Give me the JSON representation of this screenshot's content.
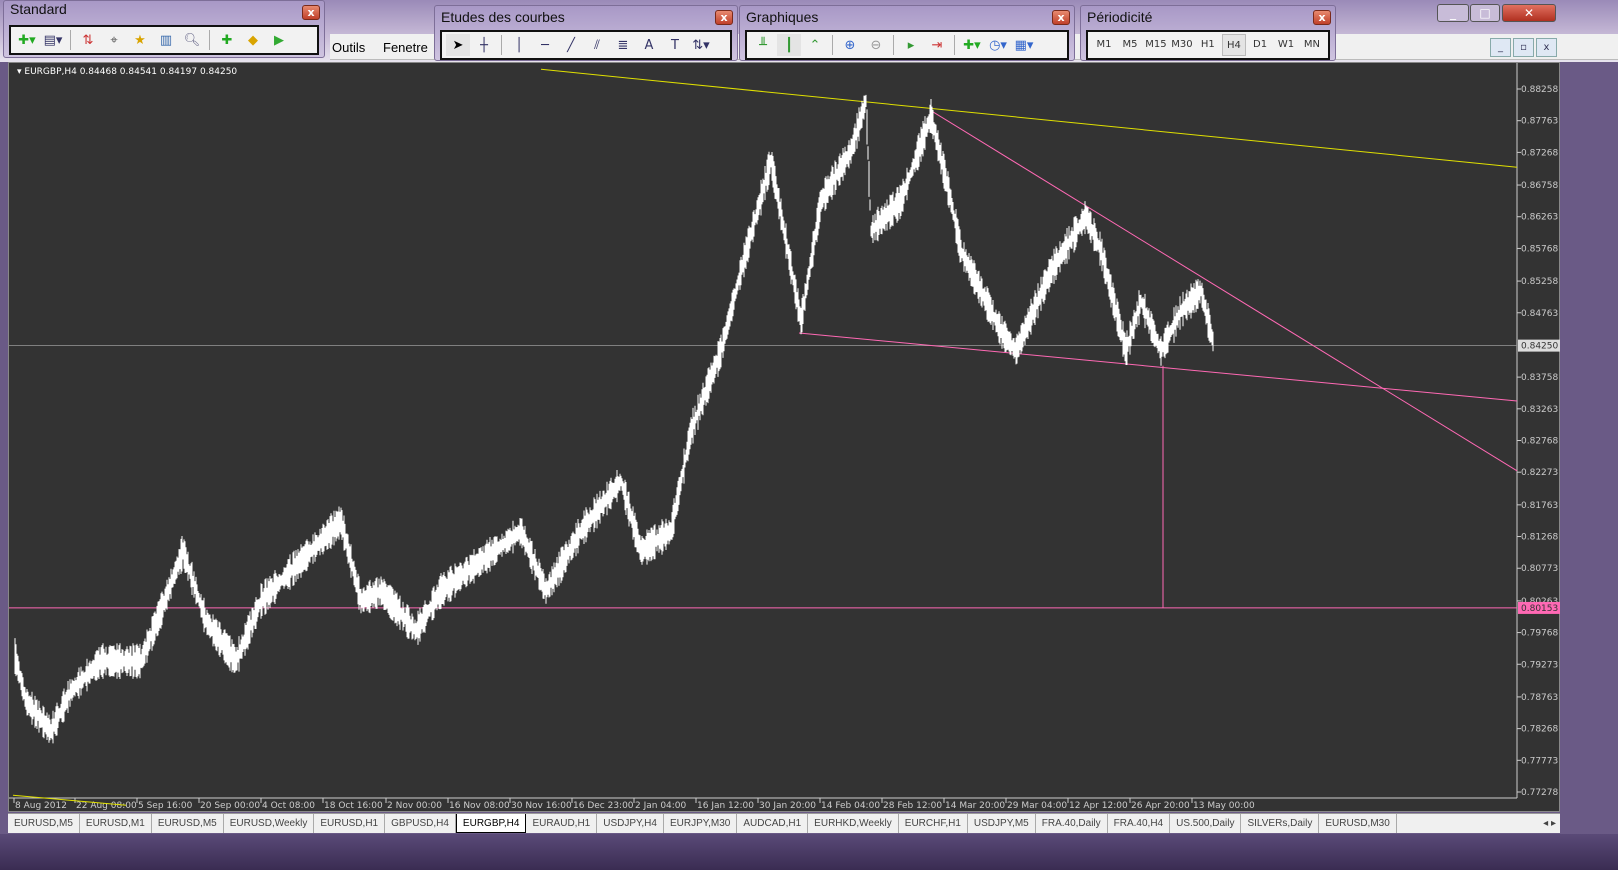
{
  "menu": {
    "tools": "Outils",
    "window": "Fenetre"
  },
  "toolbars": {
    "standard": {
      "title": "Standard",
      "close": "x"
    },
    "studies": {
      "title": "Etudes des courbes",
      "close": "x",
      "text_tool": "A",
      "textlabel_tool": "T"
    },
    "charts": {
      "title": "Graphiques",
      "close": "x"
    },
    "period": {
      "title": "Périodicité",
      "close": "x",
      "items": [
        "M1",
        "M5",
        "M15",
        "M30",
        "H1",
        "H4",
        "D1",
        "W1",
        "MN"
      ],
      "active": "H4"
    }
  },
  "chart": {
    "header": "EURGBP,H4  0.84468 0.84541 0.84197 0.84250"
  },
  "tabs": [
    "EURUSD,M5",
    "EURUSD,M1",
    "EURUSD,M5",
    "EURUSD,Weekly",
    "EURUSD,H1",
    "GBPUSD,H4",
    "EURGBP,H4",
    "EURAUD,H1",
    "USDJPY,H4",
    "EURJPY,M30",
    "AUDCAD,H1",
    "EURHKD,Weekly",
    "EURCHF,H1",
    "USDJPY,M5",
    "FRA.40,Daily",
    "FRA.40,H4",
    "US.500,Daily",
    "SILVERs,Daily",
    "EURUSD,M30"
  ],
  "active_tab": "EURGBP,H4",
  "chart_data": {
    "type": "line",
    "symbol": "EURGBP",
    "timeframe": "H4",
    "ylim": [
      0.77278,
      0.88258
    ],
    "xlim": [
      0,
      1504
    ],
    "yticks": [
      "0.88258",
      "0.87763",
      "0.87268",
      "0.86758",
      "0.86263",
      "0.85768",
      "0.85258",
      "0.84763",
      "0.83758",
      "0.83263",
      "0.82768",
      "0.82273",
      "0.81763",
      "0.81268",
      "0.80773",
      "0.80263",
      "0.79768",
      "0.79273",
      "0.78763",
      "0.78268",
      "0.77773",
      "0.77278"
    ],
    "xticks": [
      {
        "bar": 1,
        "label": "8 Aug 2012"
      },
      {
        "bar": 62,
        "label": "22 Aug 08:00"
      },
      {
        "bar": 124,
        "label": "5 Sep 16:00"
      },
      {
        "bar": 186,
        "label": "20 Sep 00:00"
      },
      {
        "bar": 248,
        "label": "4 Oct 08:00"
      },
      {
        "bar": 310,
        "label": "18 Oct 16:00"
      },
      {
        "bar": 373,
        "label": "2 Nov 00:00"
      },
      {
        "bar": 435,
        "label": "16 Nov 08:00"
      },
      {
        "bar": 497,
        "label": "30 Nov 16:00"
      },
      {
        "bar": 559,
        "label": "16 Dec 23:00"
      },
      {
        "bar": 621,
        "label": "2 Jan 04:00"
      },
      {
        "bar": 683,
        "label": "16 Jan 12:00"
      },
      {
        "bar": 745,
        "label": "30 Jan 20:00"
      },
      {
        "bar": 807,
        "label": "14 Feb 04:00"
      },
      {
        "bar": 869,
        "label": "28 Feb 12:00"
      },
      {
        "bar": 931,
        "label": "14 Mar 20:00"
      },
      {
        "bar": 993,
        "label": "29 Mar 04:00"
      },
      {
        "bar": 1055,
        "label": "12 Apr 12:00"
      },
      {
        "bar": 1117,
        "label": "26 Apr 20:00"
      },
      {
        "bar": 1179,
        "label": "13 May 00:00"
      }
    ],
    "price_path": [
      [
        2,
        0.79401
      ],
      [
        13,
        0.78698
      ],
      [
        38,
        0.7823
      ],
      [
        58,
        0.78855
      ],
      [
        88,
        0.79323
      ],
      [
        128,
        0.79323
      ],
      [
        148,
        0.80104
      ],
      [
        170,
        0.81042
      ],
      [
        193,
        0.79948
      ],
      [
        223,
        0.79323
      ],
      [
        248,
        0.80261
      ],
      [
        278,
        0.80729
      ],
      [
        328,
        0.8151
      ],
      [
        348,
        0.80261
      ],
      [
        368,
        0.80417
      ],
      [
        403,
        0.79792
      ],
      [
        428,
        0.80417
      ],
      [
        468,
        0.80885
      ],
      [
        508,
        0.81354
      ],
      [
        533,
        0.80417
      ],
      [
        568,
        0.81354
      ],
      [
        608,
        0.82135
      ],
      [
        628,
        0.81042
      ],
      [
        658,
        0.81354
      ],
      [
        678,
        0.82916
      ],
      [
        708,
        0.84166
      ],
      [
        728,
        0.85415
      ],
      [
        758,
        0.87133
      ],
      [
        788,
        0.84634
      ],
      [
        808,
        0.86509
      ],
      [
        838,
        0.8729
      ],
      [
        853,
        0.88071
      ],
      [
        858,
        0.8604
      ],
      [
        888,
        0.86509
      ],
      [
        918,
        0.87836
      ],
      [
        938,
        0.86509
      ],
      [
        948,
        0.85728
      ],
      [
        988,
        0.84478
      ],
      [
        1003,
        0.84166
      ],
      [
        1038,
        0.85415
      ],
      [
        1073,
        0.86274
      ],
      [
        1088,
        0.85728
      ],
      [
        1113,
        0.84166
      ],
      [
        1128,
        0.84947
      ],
      [
        1148,
        0.84166
      ],
      [
        1168,
        0.8479
      ],
      [
        1188,
        0.85103
      ],
      [
        1201,
        0.8425
      ]
    ],
    "bid": {
      "price": 0.8425,
      "label": "0.84250",
      "color": "#dddddd"
    },
    "hline": {
      "price": 0.80153,
      "label": "0.80153",
      "color": "#ff69b4"
    },
    "trendlines": [
      {
        "color": "#e0e000",
        "p1": [
          528,
          0.88566
        ],
        "p2": [
          1504,
          0.87036
        ]
      },
      {
        "color": "#e0e000",
        "p1": [
          0,
          0.77227
        ],
        "p2": [
          113,
          0.77071
        ]
      },
      {
        "color": "#ff69b4",
        "p1": [
          786,
          0.84447
        ],
        "p2": [
          1504,
          0.83385
        ]
      },
      {
        "color": "#ff69b4",
        "p1": [
          918,
          0.8792
        ],
        "p2": [
          1504,
          0.82294
        ]
      },
      {
        "color": "#ff69b4",
        "p1": [
          1150,
          0.83936
        ],
        "p2": [
          1150,
          0.80153
        ]
      }
    ]
  }
}
